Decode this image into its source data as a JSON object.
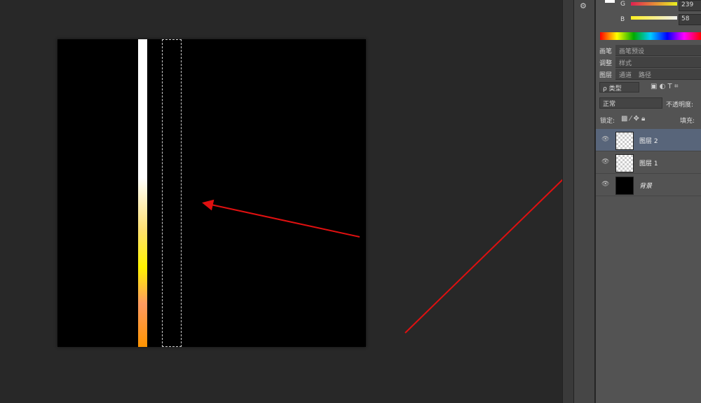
{
  "color_panel": {
    "g_label": "G",
    "g_value": "239",
    "b_label": "B",
    "b_value": "58"
  },
  "tabs_row1": [
    "画笔",
    "画笔预设"
  ],
  "tabs_row2": [
    "调整",
    "样式"
  ],
  "tabs_row3": [
    "图层",
    "通道",
    "路径"
  ],
  "layers": {
    "filter": "ρ 类型",
    "blend_mode": "正常",
    "opacity_label": "不透明度:",
    "lock_label": "锁定:",
    "fill_label": "填充:",
    "items": [
      {
        "name": "图层 2",
        "selected": true
      },
      {
        "name": "图层 1",
        "selected": false
      },
      {
        "name": "背景",
        "selected": false
      }
    ]
  },
  "annotation_color": "#e01010"
}
